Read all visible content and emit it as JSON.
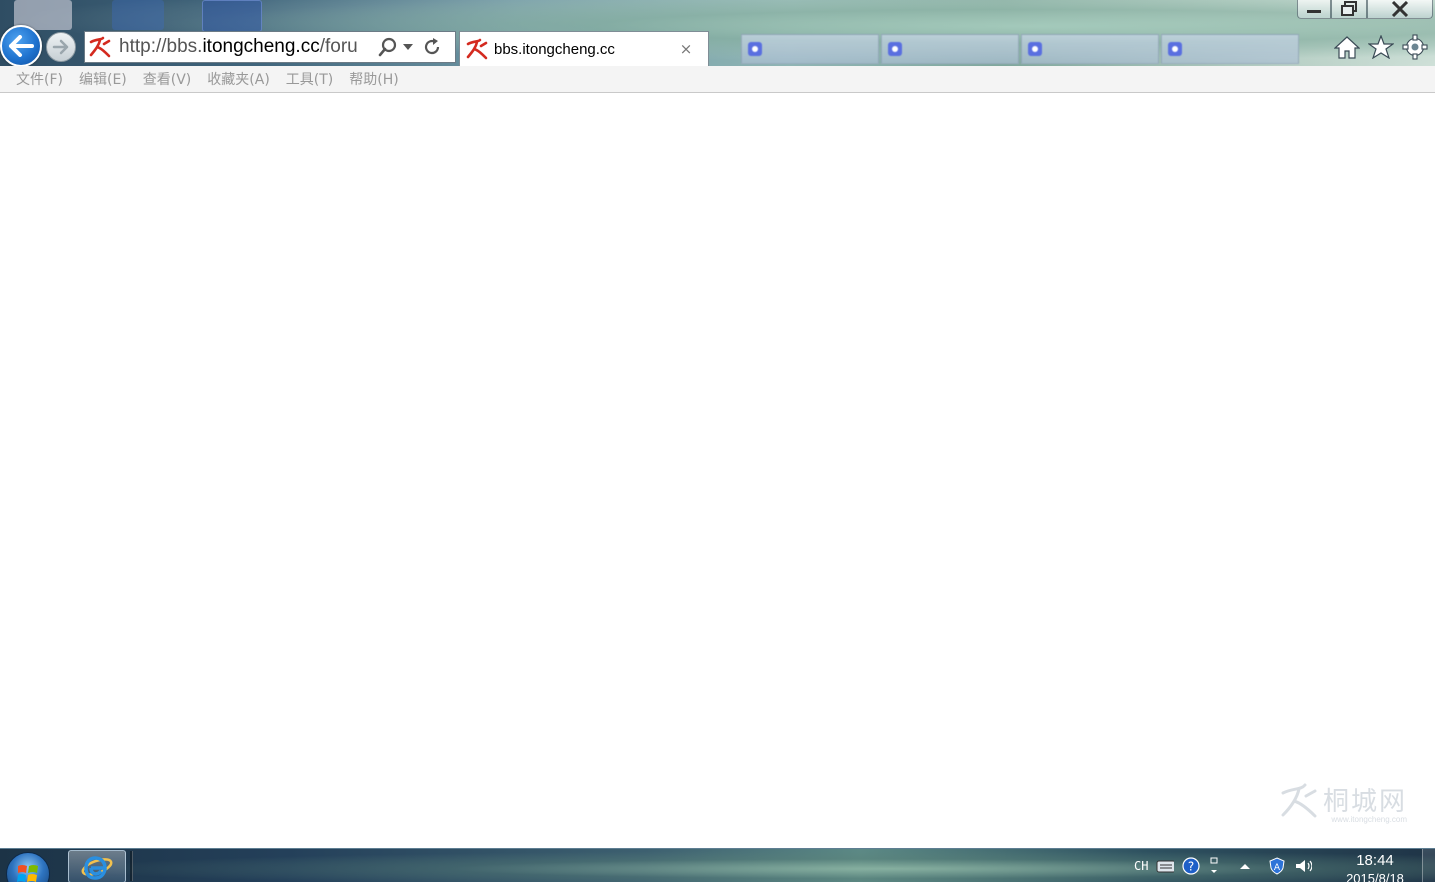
{
  "browser": {
    "address_bar": {
      "url_prefix": "http://bbs.",
      "url_host": "itongcheng.cc",
      "url_suffix": "/foru"
    },
    "active_tab": {
      "title": "bbs.itongcheng.cc",
      "close_glyph": "×"
    },
    "inactive_tabs": [
      {
        "icon": "ie-page-icon",
        "label": ""
      },
      {
        "icon": "ie-page-icon",
        "label": ""
      },
      {
        "icon": "ie-page-icon",
        "label": ""
      },
      {
        "icon": "ie-page-icon",
        "label": ""
      }
    ],
    "menu": [
      "文件(F)",
      "编辑(E)",
      "查看(V)",
      "收藏夹(A)",
      "工具(T)",
      "帮助(H)"
    ]
  },
  "watermark": {
    "text": "桐城网",
    "sub": "www.itongcheng.com"
  },
  "taskbar": {
    "language": "CH",
    "time": "18:44",
    "date": "2015/8/18"
  },
  "colors": {
    "back_button": "#1f73cf",
    "favicon_red": "#d42a1f",
    "menu_text": "#999999"
  }
}
